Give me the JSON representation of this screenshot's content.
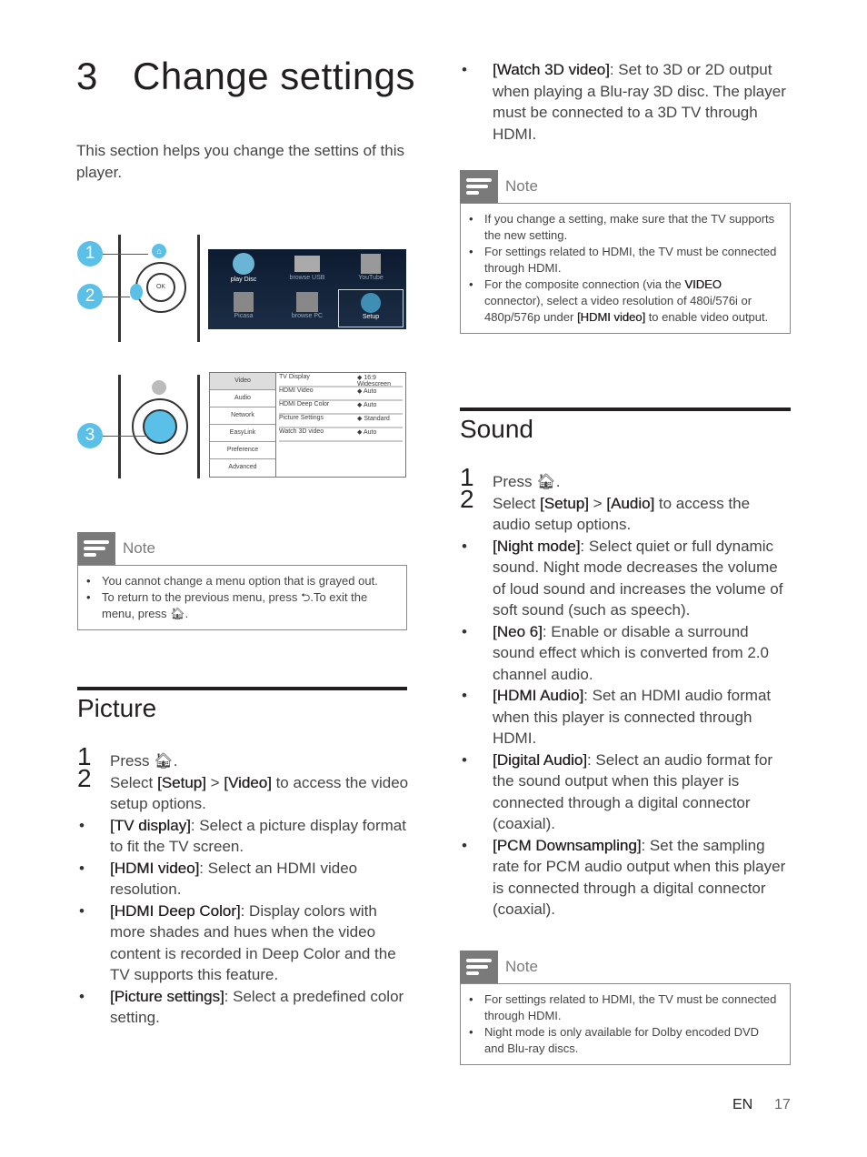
{
  "chapter": {
    "number": "3",
    "title": "Change settings"
  },
  "intro": "This section helps you change the settins of this player.",
  "figures": {
    "callouts": [
      "1",
      "2",
      "3"
    ],
    "home_screen": {
      "items": [
        "play Disc",
        "browse USB",
        "YouTube",
        "Picasa",
        "browse PC",
        "Setup"
      ],
      "selected": "Setup"
    },
    "setup_menu": {
      "categories": [
        "Video",
        "Audio",
        "Network",
        "EasyLink",
        "Preference",
        "Advanced"
      ],
      "selected_category": "Video",
      "options": [
        {
          "name": "TV Display",
          "value": "16:9 Widescreen"
        },
        {
          "name": "HDMI Video",
          "value": "Auto"
        },
        {
          "name": "HDMI Deep Color",
          "value": "Auto"
        },
        {
          "name": "Picture Settings",
          "value": "Standard"
        },
        {
          "name": "Watch 3D video",
          "value": "Auto"
        }
      ]
    }
  },
  "note1": {
    "title": "Note",
    "items": [
      "You cannot change a menu option that is grayed out.",
      "To return to the previous menu, press ⮌.To exit the menu, press 🏠︎."
    ]
  },
  "picture": {
    "heading": "Picture",
    "step1": {
      "num": "1",
      "text": "Press 🏠︎."
    },
    "step2": {
      "num": "2",
      "pre": "Select ",
      "b1": "[Setup]",
      "mid": " > ",
      "b2": "[Video]",
      "post": " to access the video setup options."
    },
    "bullets": [
      {
        "term": "[TV display]",
        "text": ": Select a picture display format to fit the TV screen."
      },
      {
        "term": "[HDMI video]",
        "text": ": Select an HDMI video resolution."
      },
      {
        "term": "[HDMI Deep Color]",
        "text": ": Display colors with more shades and hues when the video content is recorded in Deep Color and the TV supports this feature."
      },
      {
        "term": "[Picture settings]",
        "text": ": Select a predefined color setting."
      }
    ]
  },
  "right_top_bullet": {
    "term": "[Watch 3D video]",
    "text": ": Set to 3D or 2D output when playing a Blu-ray 3D disc. The player must be connected to a 3D TV through HDMI."
  },
  "note2": {
    "title": "Note",
    "items": [
      {
        "text": "If you change a setting, make sure that the TV supports the new setting."
      },
      {
        "text": "For settings related to HDMI, the TV must be connected through HDMI."
      },
      {
        "pre": "For the composite connection (via the ",
        "b1": "VIDEO",
        "mid": " connector), select a video resolution of 480i/576i or 480p/576p under ",
        "b2": "[HDMI video]",
        "post": " to enable video output."
      }
    ]
  },
  "sound": {
    "heading": "Sound",
    "step1": {
      "num": "1",
      "text": "Press 🏠︎."
    },
    "step2": {
      "num": "2",
      "pre": "Select ",
      "b1": "[Setup]",
      "mid": " > ",
      "b2": "[Audio]",
      "post": " to access the audio setup options."
    },
    "bullets": [
      {
        "term": "[Night mode]",
        "text": ": Select quiet or full dynamic sound. Night mode decreases the volume of loud sound and increases the volume of soft sound (such as speech)."
      },
      {
        "term": "[Neo 6]",
        "text": ": Enable or disable a surround sound effect which is converted from 2.0 channel audio."
      },
      {
        "term": "[HDMI Audio]",
        "text": ": Set an HDMI audio format when this player is connected through HDMI."
      },
      {
        "term": "[Digital Audio]",
        "text": ": Select an audio format for the sound output when this player is connected through a digital connector (coaxial)."
      },
      {
        "term": "[PCM Downsampling]",
        "text": ": Set the sampling rate for PCM audio output when this player is connected through a digital connector (coaxial)."
      }
    ]
  },
  "note3": {
    "title": "Note",
    "items": [
      "For settings related to HDMI, the TV must be connected through HDMI.",
      "Night mode is only available for Dolby encoded DVD and Blu-ray discs."
    ]
  },
  "footer": {
    "lang": "EN",
    "page": "17"
  }
}
